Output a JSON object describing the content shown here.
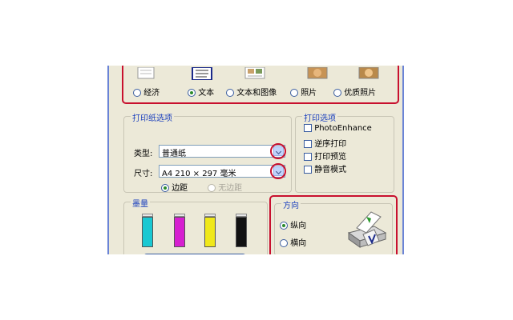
{
  "quality": {
    "options": [
      {
        "label": "经济",
        "selected": false
      },
      {
        "label": "文本",
        "selected": true
      },
      {
        "label": "文本和图像",
        "selected": false
      },
      {
        "label": "照片",
        "selected": false
      },
      {
        "label": "优质照片",
        "selected": false
      }
    ]
  },
  "paper": {
    "legend": "打印纸选项",
    "type_label": "类型:",
    "type_value": "普通纸",
    "size_label": "尺寸:",
    "size_value": "A4 210 × 297 毫米",
    "margin_label": "边距",
    "borderless_label": "无边距"
  },
  "print_options": {
    "legend": "打印选项",
    "items": [
      {
        "label": "PhotoEnhance",
        "checked": false
      },
      {
        "label": "逆序打印",
        "checked": false
      },
      {
        "label": "打印预览",
        "checked": false
      },
      {
        "label": "静音模式",
        "checked": false
      }
    ]
  },
  "ink": {
    "legend": "墨量",
    "colors": [
      "#19c8d2",
      "#d61fd0",
      "#f0e81a",
      "#111111"
    ]
  },
  "orientation": {
    "legend": "方向",
    "portrait_label": "纵向",
    "landscape_label": "横向",
    "selected": "portrait"
  },
  "colors": {
    "accent_red": "#c8102e",
    "legend_blue": "#1a3fbd",
    "dialog_bg": "#ece9d8"
  }
}
